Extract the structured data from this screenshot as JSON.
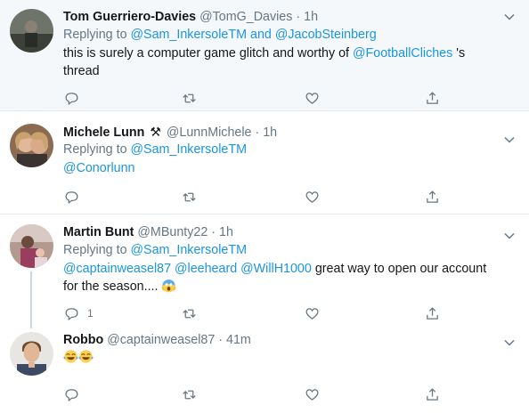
{
  "tweets": [
    {
      "name": "Tom Guerriero-Davies",
      "handle": "@TomG_Davies",
      "dot": "·",
      "time": "1h",
      "replying_prefix": "Replying to",
      "replying_targets": "@Sam_InkersoleTM and @JacobSteinberg",
      "text_before": "this is surely a computer game glitch and worthy of",
      "text_link": "@FootballCliches",
      "text_after": "'s",
      "text_line2": "thread"
    },
    {
      "name": "Michele Lunn",
      "badge_icon": "hammer-and-pick-icon",
      "handle": "@LunnMichele",
      "dot": "·",
      "time": "1h",
      "replying_prefix": "Replying to",
      "replying_targets": "@Sam_InkersoleTM",
      "text_link": "@Conorlunn"
    },
    {
      "name": "Martin Bunt",
      "handle": "@MBunty22",
      "dot": "·",
      "time": "1h",
      "replying_prefix": "Replying to",
      "replying_targets": "@Sam_InkersoleTM",
      "mention1": "@captainweasel87",
      "mention2": "@leeheard",
      "mention3": "@WillH1000",
      "text_after": "great way to open our account",
      "text_line2": "for the season....",
      "emoji_icon": "screaming-face-emoji",
      "reply_count": "1"
    },
    {
      "name": "Robbo",
      "handle": "@captainweasel87",
      "dot": "·",
      "time": "41m",
      "emoji_icons": [
        "tears-of-joy-emoji",
        "tears-of-joy-emoji"
      ]
    }
  ],
  "colors": {
    "link": "#1b95e0",
    "muted": "#657786",
    "text": "#14171a",
    "highlight_bg": "#f5f8fa",
    "divider": "#e6ecf0"
  },
  "icons": {
    "reply": "reply-icon",
    "retweet": "retweet-icon",
    "like": "heart-icon",
    "share": "share-icon",
    "more": "chevron-down-icon"
  }
}
